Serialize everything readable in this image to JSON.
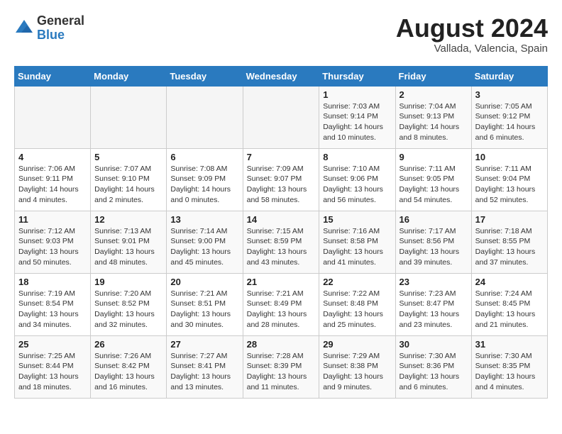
{
  "header": {
    "logo_general": "General",
    "logo_blue": "Blue",
    "month_year": "August 2024",
    "location": "Vallada, Valencia, Spain"
  },
  "weekdays": [
    "Sunday",
    "Monday",
    "Tuesday",
    "Wednesday",
    "Thursday",
    "Friday",
    "Saturday"
  ],
  "weeks": [
    [
      {
        "day": "",
        "info": ""
      },
      {
        "day": "",
        "info": ""
      },
      {
        "day": "",
        "info": ""
      },
      {
        "day": "",
        "info": ""
      },
      {
        "day": "1",
        "info": "Sunrise: 7:03 AM\nSunset: 9:14 PM\nDaylight: 14 hours\nand 10 minutes."
      },
      {
        "day": "2",
        "info": "Sunrise: 7:04 AM\nSunset: 9:13 PM\nDaylight: 14 hours\nand 8 minutes."
      },
      {
        "day": "3",
        "info": "Sunrise: 7:05 AM\nSunset: 9:12 PM\nDaylight: 14 hours\nand 6 minutes."
      }
    ],
    [
      {
        "day": "4",
        "info": "Sunrise: 7:06 AM\nSunset: 9:11 PM\nDaylight: 14 hours\nand 4 minutes."
      },
      {
        "day": "5",
        "info": "Sunrise: 7:07 AM\nSunset: 9:10 PM\nDaylight: 14 hours\nand 2 minutes."
      },
      {
        "day": "6",
        "info": "Sunrise: 7:08 AM\nSunset: 9:09 PM\nDaylight: 14 hours\nand 0 minutes."
      },
      {
        "day": "7",
        "info": "Sunrise: 7:09 AM\nSunset: 9:07 PM\nDaylight: 13 hours\nand 58 minutes."
      },
      {
        "day": "8",
        "info": "Sunrise: 7:10 AM\nSunset: 9:06 PM\nDaylight: 13 hours\nand 56 minutes."
      },
      {
        "day": "9",
        "info": "Sunrise: 7:11 AM\nSunset: 9:05 PM\nDaylight: 13 hours\nand 54 minutes."
      },
      {
        "day": "10",
        "info": "Sunrise: 7:11 AM\nSunset: 9:04 PM\nDaylight: 13 hours\nand 52 minutes."
      }
    ],
    [
      {
        "day": "11",
        "info": "Sunrise: 7:12 AM\nSunset: 9:03 PM\nDaylight: 13 hours\nand 50 minutes."
      },
      {
        "day": "12",
        "info": "Sunrise: 7:13 AM\nSunset: 9:01 PM\nDaylight: 13 hours\nand 48 minutes."
      },
      {
        "day": "13",
        "info": "Sunrise: 7:14 AM\nSunset: 9:00 PM\nDaylight: 13 hours\nand 45 minutes."
      },
      {
        "day": "14",
        "info": "Sunrise: 7:15 AM\nSunset: 8:59 PM\nDaylight: 13 hours\nand 43 minutes."
      },
      {
        "day": "15",
        "info": "Sunrise: 7:16 AM\nSunset: 8:58 PM\nDaylight: 13 hours\nand 41 minutes."
      },
      {
        "day": "16",
        "info": "Sunrise: 7:17 AM\nSunset: 8:56 PM\nDaylight: 13 hours\nand 39 minutes."
      },
      {
        "day": "17",
        "info": "Sunrise: 7:18 AM\nSunset: 8:55 PM\nDaylight: 13 hours\nand 37 minutes."
      }
    ],
    [
      {
        "day": "18",
        "info": "Sunrise: 7:19 AM\nSunset: 8:54 PM\nDaylight: 13 hours\nand 34 minutes."
      },
      {
        "day": "19",
        "info": "Sunrise: 7:20 AM\nSunset: 8:52 PM\nDaylight: 13 hours\nand 32 minutes."
      },
      {
        "day": "20",
        "info": "Sunrise: 7:21 AM\nSunset: 8:51 PM\nDaylight: 13 hours\nand 30 minutes."
      },
      {
        "day": "21",
        "info": "Sunrise: 7:21 AM\nSunset: 8:49 PM\nDaylight: 13 hours\nand 28 minutes."
      },
      {
        "day": "22",
        "info": "Sunrise: 7:22 AM\nSunset: 8:48 PM\nDaylight: 13 hours\nand 25 minutes."
      },
      {
        "day": "23",
        "info": "Sunrise: 7:23 AM\nSunset: 8:47 PM\nDaylight: 13 hours\nand 23 minutes."
      },
      {
        "day": "24",
        "info": "Sunrise: 7:24 AM\nSunset: 8:45 PM\nDaylight: 13 hours\nand 21 minutes."
      }
    ],
    [
      {
        "day": "25",
        "info": "Sunrise: 7:25 AM\nSunset: 8:44 PM\nDaylight: 13 hours\nand 18 minutes."
      },
      {
        "day": "26",
        "info": "Sunrise: 7:26 AM\nSunset: 8:42 PM\nDaylight: 13 hours\nand 16 minutes."
      },
      {
        "day": "27",
        "info": "Sunrise: 7:27 AM\nSunset: 8:41 PM\nDaylight: 13 hours\nand 13 minutes."
      },
      {
        "day": "28",
        "info": "Sunrise: 7:28 AM\nSunset: 8:39 PM\nDaylight: 13 hours\nand 11 minutes."
      },
      {
        "day": "29",
        "info": "Sunrise: 7:29 AM\nSunset: 8:38 PM\nDaylight: 13 hours\nand 9 minutes."
      },
      {
        "day": "30",
        "info": "Sunrise: 7:30 AM\nSunset: 8:36 PM\nDaylight: 13 hours\nand 6 minutes."
      },
      {
        "day": "31",
        "info": "Sunrise: 7:30 AM\nSunset: 8:35 PM\nDaylight: 13 hours\nand 4 minutes."
      }
    ]
  ]
}
